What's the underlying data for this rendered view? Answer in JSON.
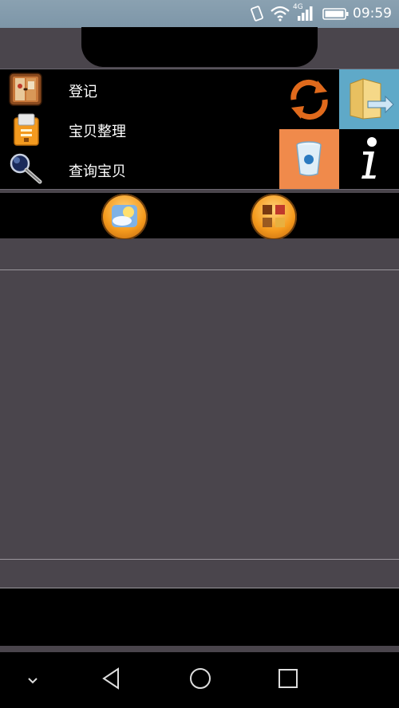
{
  "status": {
    "time": "09:59",
    "network": "4G"
  },
  "menu": {
    "items": [
      {
        "label": "登记"
      },
      {
        "label": "宝贝整理"
      },
      {
        "label": "查询宝贝"
      }
    ]
  },
  "tiles": {
    "sync_color": "#000000",
    "folder_color": "#5fa9c8",
    "trash_color": "#f08a4b",
    "info_color": "#000000"
  },
  "colors": {
    "background": "#4a454c",
    "panel": "#000000",
    "accent_orange": "#f59a1d"
  }
}
